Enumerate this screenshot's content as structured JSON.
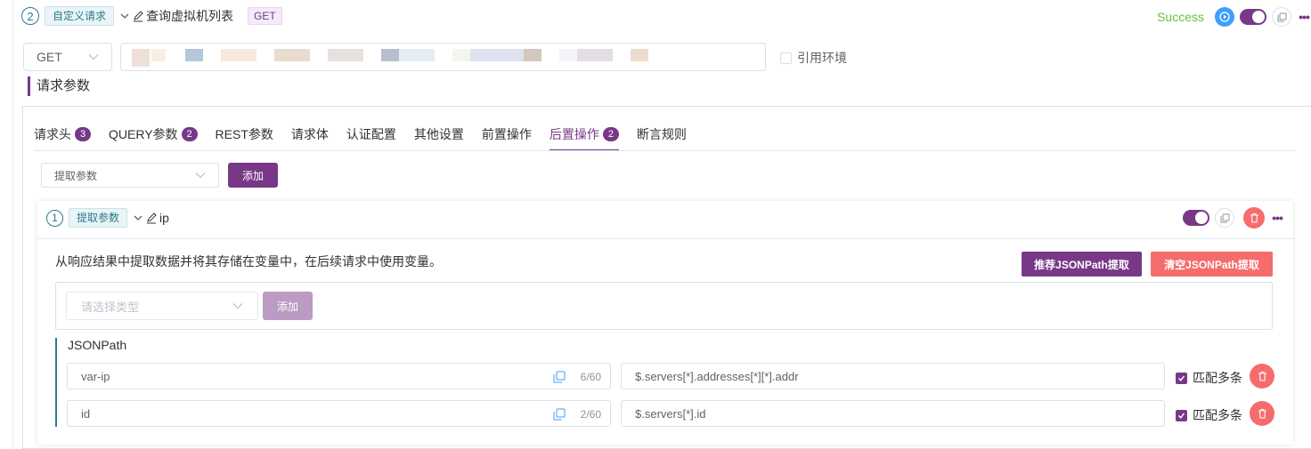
{
  "header": {
    "step_number": "2",
    "type_tag": "自定义请求",
    "title": "查询虚拟机列表",
    "method_tag": "GET",
    "status": "Success"
  },
  "request": {
    "method": "GET",
    "use_env_label": "引用环境"
  },
  "section_title": "请求参数",
  "tabs": [
    {
      "label": "请求头",
      "badge": "3"
    },
    {
      "label": "QUERY参数",
      "badge": "2"
    },
    {
      "label": "REST参数",
      "badge": ""
    },
    {
      "label": "请求体",
      "badge": ""
    },
    {
      "label": "认证配置",
      "badge": ""
    },
    {
      "label": "其他设置",
      "badge": ""
    },
    {
      "label": "前置操作",
      "badge": ""
    },
    {
      "label": "后置操作",
      "badge": "2"
    },
    {
      "label": "断言规则",
      "badge": ""
    }
  ],
  "post_ops": {
    "select_value": "提取参数",
    "add_label": "添加"
  },
  "extract_card": {
    "step_number": "1",
    "type_tag": "提取参数",
    "name": "ip",
    "description": "从响应结果中提取数据并将其存储在变量中，在后续请求中使用变量。",
    "recommend_btn": "推荐JSONPath提取",
    "clear_btn": "清空JSONPath提取",
    "type_placeholder": "请选择类型",
    "type_add_label": "添加",
    "jsonpath_label": "JSONPath",
    "rows": [
      {
        "name": "var-ip",
        "count": "6/60",
        "path": "$.servers[*].addresses[*][*].addr",
        "multi_label": "匹配多条"
      },
      {
        "name": "id",
        "count": "2/60",
        "path": "$.servers[*].id",
        "multi_label": "匹配多条"
      }
    ]
  },
  "colors": {
    "primary": "#783887",
    "teal": "#2b7a8c",
    "danger": "#f56c6c",
    "success": "#67c23a",
    "info": "#409eff"
  }
}
